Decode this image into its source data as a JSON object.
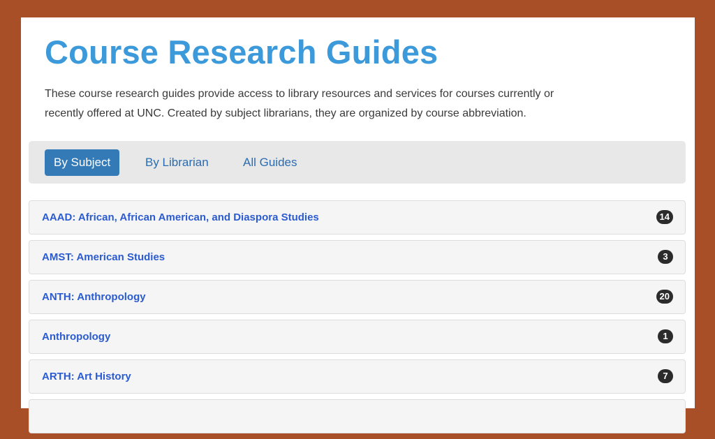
{
  "header": {
    "title": "Course Research Guides",
    "description": "These course research guides provide access to library resources and services for courses currently or recently offered at UNC. Created by subject librarians, they are organized by course abbreviation."
  },
  "tabs": [
    {
      "label": "By Subject",
      "active": true
    },
    {
      "label": "By Librarian",
      "active": false
    },
    {
      "label": "All Guides",
      "active": false
    }
  ],
  "subjects": [
    {
      "label": "AAAD: African, African American, and Diaspora Studies",
      "count": "14"
    },
    {
      "label": "AMST: American Studies",
      "count": "3"
    },
    {
      "label": "ANTH: Anthropology",
      "count": "20"
    },
    {
      "label": "Anthropology",
      "count": "1"
    },
    {
      "label": "ARTH: Art History",
      "count": "7"
    }
  ],
  "colors": {
    "frame": "#A84F27",
    "title": "#3C9ADB",
    "active_tab": "#337AB7",
    "link": "#2B5BD1",
    "badge": "#2B2B2B"
  }
}
